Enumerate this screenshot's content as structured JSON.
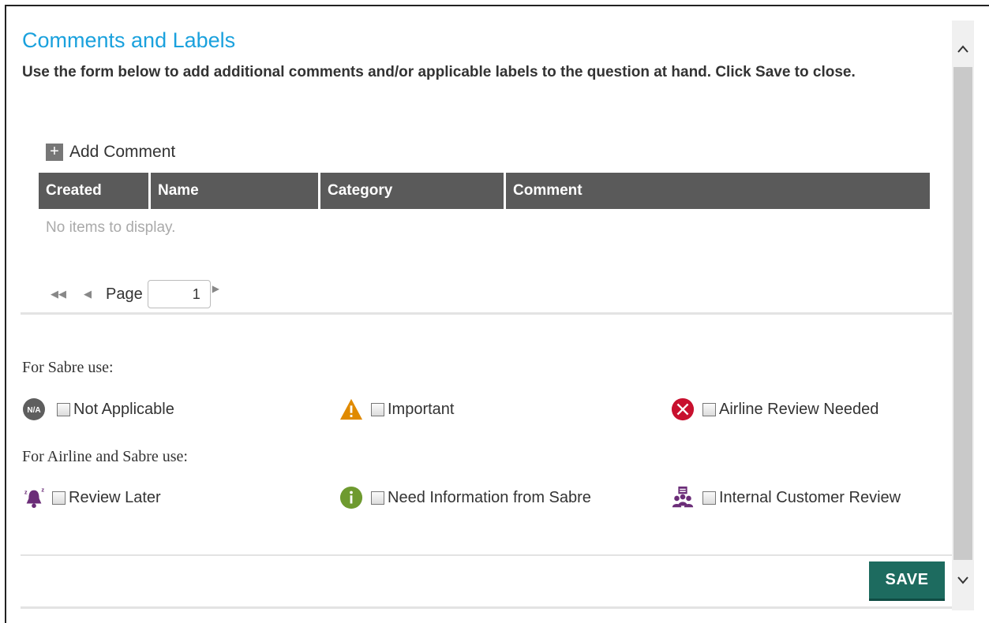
{
  "dialog": {
    "title": "Comments and Labels",
    "instructions": "Use the form below to add additional comments and/or applicable labels to the question at hand. Click Save to close."
  },
  "comments": {
    "add_label": "Add Comment",
    "columns": [
      "Created",
      "Name",
      "Category",
      "Comment"
    ],
    "empty_message": "No items to display.",
    "pager": {
      "page_label": "Page",
      "page_value": "1"
    }
  },
  "labels": {
    "sabre_heading": "For Sabre use:",
    "sabre_items": [
      {
        "label": "Not Applicable",
        "icon": "na-icon",
        "checked": false
      },
      {
        "label": "Important",
        "icon": "warning-icon",
        "checked": false
      },
      {
        "label": "Airline Review Needed",
        "icon": "x-circle-icon",
        "checked": false
      }
    ],
    "airline_heading": "For Airline and Sabre use:",
    "airline_items": [
      {
        "label": "Review Later",
        "icon": "bell-snooze-icon",
        "checked": false
      },
      {
        "label": "Need Information from Sabre",
        "icon": "info-icon",
        "checked": false
      },
      {
        "label": "Internal Customer Review",
        "icon": "people-review-icon",
        "checked": false
      }
    ],
    "na_icon_text": "N/A"
  },
  "actions": {
    "save_label": "SAVE"
  },
  "colors": {
    "title": "#1aa1dd",
    "grid_header": "#5a5a5a",
    "save_button": "#1d6b5f",
    "warning": "#e08a00",
    "error": "#c8102e",
    "info": "#6e9a2f",
    "review": "#6b2d78"
  }
}
